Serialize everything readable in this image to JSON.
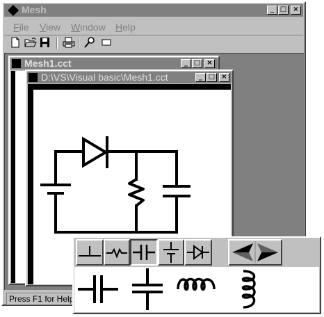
{
  "app": {
    "title": "Mesh",
    "menu": [
      {
        "label": "File",
        "mnemonic": "F",
        "rest": "ile"
      },
      {
        "label": "View",
        "mnemonic": "V",
        "rest": "iew"
      },
      {
        "label": "Window",
        "mnemonic": "W",
        "rest": "indow"
      },
      {
        "label": "Help",
        "mnemonic": "H",
        "rest": "elp"
      }
    ],
    "toolbar": [
      "new-document-icon",
      "open-folder-icon",
      "save-disk-icon",
      "print-icon",
      "probe-icon",
      "rectangle-icon"
    ],
    "status_text": "Press F1 for Help"
  },
  "caption_buttons": {
    "minimize": "_",
    "maximize": "□",
    "close": "×"
  },
  "child_windows": {
    "back_title": "Mesh1.cct",
    "front_title": "D:\\VS\\Visual basic\\Mesh1.cct"
  },
  "palette": {
    "buttons": [
      "wire",
      "resistor",
      "capacitor",
      "battery",
      "diode"
    ],
    "selected": "capacitor",
    "nav": [
      "left-arrow-icon",
      "right-arrow-icon"
    ],
    "previews": [
      "capacitor-symbol-horizontal",
      "capacitor-symbol-vertical",
      "inductor-symbol-horizontal",
      "inductor-symbol-vertical"
    ]
  },
  "circuit": {
    "components": [
      "battery",
      "diode",
      "resistor",
      "capacitor"
    ]
  },
  "colors": {
    "desktop": "#808080",
    "window_face": "#c0c0c0",
    "active_title": "#000000",
    "inactive_title": "#808080"
  }
}
